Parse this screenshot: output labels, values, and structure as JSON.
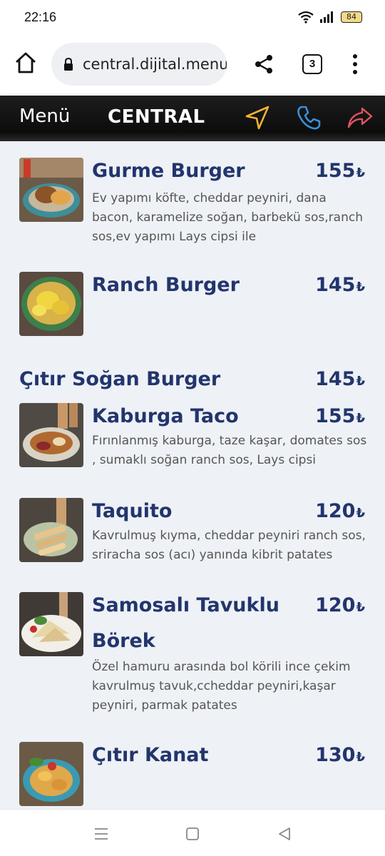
{
  "status_bar": {
    "time": "22:16",
    "battery": "84"
  },
  "browser": {
    "url": "central.dijital.menu",
    "tab_count": "3"
  },
  "header": {
    "menu_label": "Menü",
    "brand": "CENTRAL"
  },
  "currency": "₺",
  "items": [
    {
      "name": "Gurme Burger",
      "price": "155",
      "description": "Ev yapımı köfte, cheddar peyniri, dana bacon, karamelize soğan, barbekü sos,ranch sos,ev yapımı Lays cipsi ile"
    },
    {
      "name": "Ranch Burger",
      "price": "145",
      "description": ""
    },
    {
      "name": "Kaburga Taco",
      "price": "155",
      "description": "Fırınlanmış kaburga, taze kaşar, domates sos , sumaklı soğan ranch sos, Lays cipsi"
    },
    {
      "name": "Taquito",
      "price": "120",
      "description": "Kavrulmuş kıyma, cheddar peyniri ranch sos, sriracha sos (acı) yanında kibrit patates"
    },
    {
      "name_line1": "Samosalı Tavuklu",
      "name_line2": "Börek",
      "price": "120",
      "description": "Özel hamuru arasında bol körili ince çekim kavrulmuş tavuk,ccheddar peyniri,kaşar peyniri, parmak patates"
    },
    {
      "name": "Çıtır Kanat",
      "price": "130",
      "description": ""
    }
  ],
  "category_item": {
    "name": "Çıtır Soğan Burger",
    "price": "145"
  },
  "colors": {
    "title": "#22356c",
    "background": "#eef1f6",
    "location_icon": "#f2b233",
    "phone_icon": "#3a8ed8",
    "share_icon": "#e0555e"
  }
}
